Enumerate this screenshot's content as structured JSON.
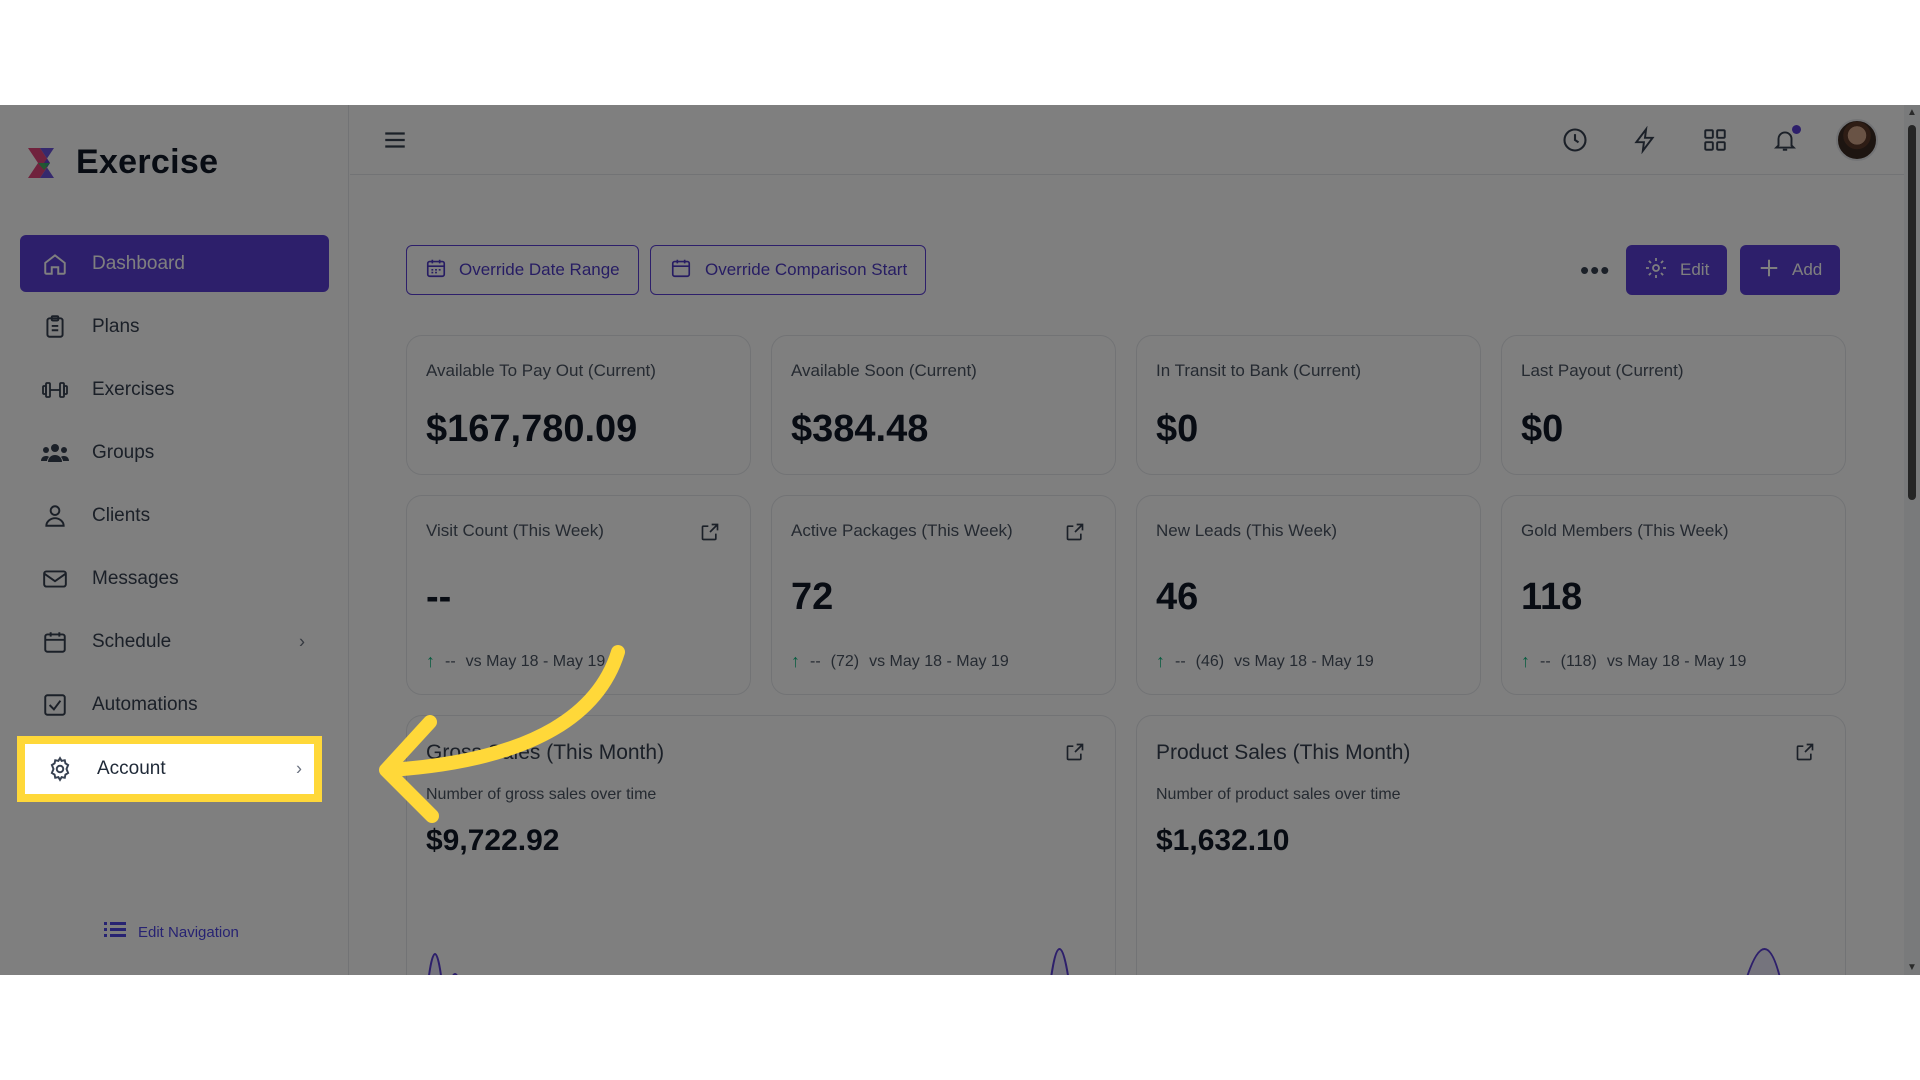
{
  "app": {
    "name": "Exercise"
  },
  "sidebar": {
    "items": [
      {
        "label": "Dashboard",
        "icon": "home-icon",
        "active": true
      },
      {
        "label": "Plans",
        "icon": "clipboard-icon"
      },
      {
        "label": "Exercises",
        "icon": "dumbbell-icon"
      },
      {
        "label": "Groups",
        "icon": "users-icon"
      },
      {
        "label": "Clients",
        "icon": "user-icon"
      },
      {
        "label": "Messages",
        "icon": "mail-icon"
      },
      {
        "label": "Schedule",
        "icon": "calendar-icon",
        "has_submenu": true
      },
      {
        "label": "Automations",
        "icon": "checkbox-icon"
      },
      {
        "label": "Account",
        "icon": "gear-icon",
        "has_submenu": true,
        "highlighted": true
      }
    ],
    "edit_navigation": "Edit Navigation"
  },
  "toolbar": {
    "override_date_range": "Override Date Range",
    "override_comparison_start": "Override Comparison Start",
    "edit": "Edit",
    "add": "Add"
  },
  "stats_row1": [
    {
      "title": "Available To Pay Out (Current)",
      "value": "$167,780.09"
    },
    {
      "title": "Available Soon (Current)",
      "value": "$384.48"
    },
    {
      "title": "In Transit to Bank (Current)",
      "value": "$0"
    },
    {
      "title": "Last Payout (Current)",
      "value": "$0"
    }
  ],
  "stats_row2": [
    {
      "title": "Visit Count (This Week)",
      "value": "--",
      "prev": "--",
      "prev_count": "",
      "comparison": "vs May 18 - May 19"
    },
    {
      "title": "Active Packages (This Week)",
      "value": "72",
      "prev": "--",
      "prev_count": "(72)",
      "comparison": "vs May 18 - May 19"
    },
    {
      "title": "New Leads (This Week)",
      "value": "46",
      "prev": "--",
      "prev_count": "(46)",
      "comparison": "vs May 18 - May 19"
    },
    {
      "title": "Gold Members (This Week)",
      "value": "118",
      "prev": "--",
      "prev_count": "(118)",
      "comparison": "vs May 18 - May 19"
    }
  ],
  "charts": [
    {
      "title": "Gross Sales (This Month)",
      "subtitle": "Number of gross sales over time",
      "value": "$9,722.92"
    },
    {
      "title": "Product Sales (This Month)",
      "subtitle": "Number of product sales over time",
      "value": "$1,632.10"
    }
  ],
  "colors": {
    "accent": "#5b3fd6",
    "highlight": "#ffd839",
    "trend_up": "#10b981"
  }
}
